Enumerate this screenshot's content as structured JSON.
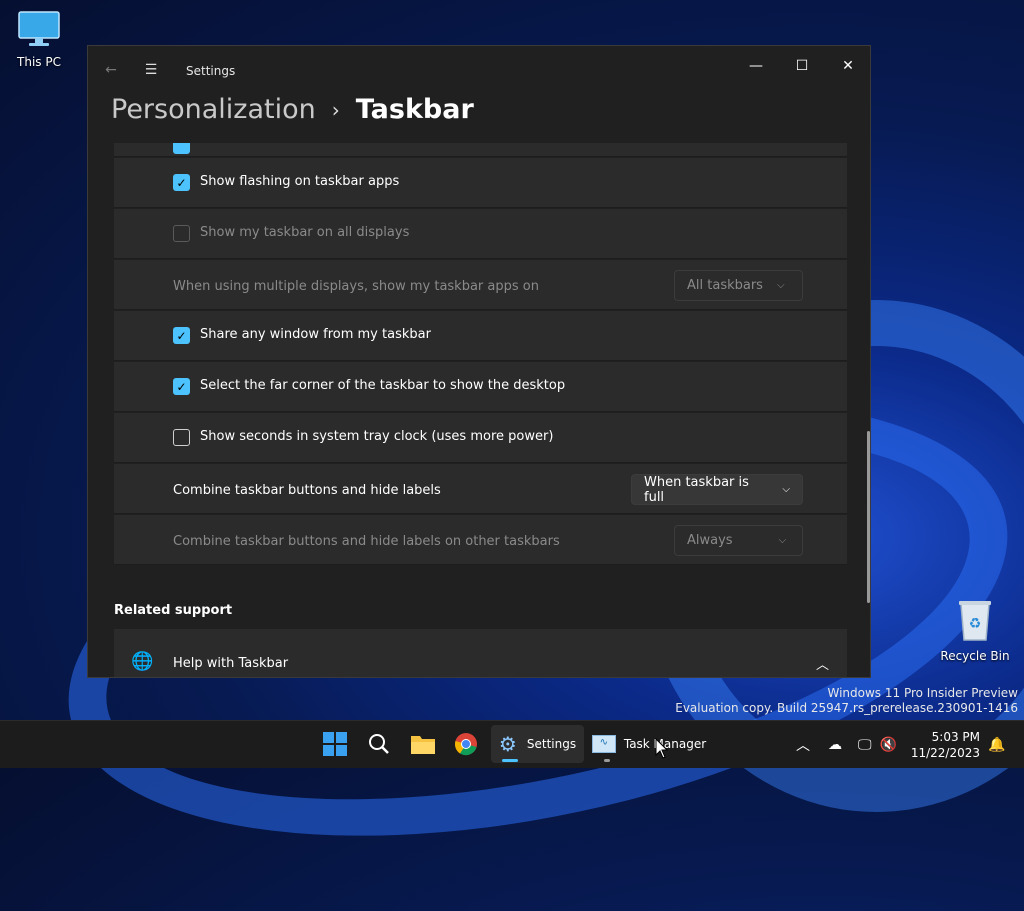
{
  "desktop": {
    "this_pc_label": "This PC",
    "recycle_bin_label": "Recycle Bin",
    "watermark_line1": "Windows 11 Pro Insider Preview",
    "watermark_line2": "Evaluation copy. Build 25947.rs_prerelease.230901-1416"
  },
  "window": {
    "app_title": "Settings",
    "breadcrumb_parent": "Personalization",
    "breadcrumb_separator": "›",
    "breadcrumb_current": "Taskbar"
  },
  "settings_rows": [
    {
      "label": "Show flashing on taskbar apps",
      "checked": true,
      "enabled": true
    },
    {
      "label": "Show my taskbar on all displays",
      "checked": false,
      "enabled": false
    },
    {
      "label": "When using multiple displays, show my taskbar apps on",
      "dropdown": "All taskbars",
      "enabled": false
    },
    {
      "label": "Share any window from my taskbar",
      "checked": true,
      "enabled": true
    },
    {
      "label": "Select the far corner of the taskbar to show the desktop",
      "checked": true,
      "enabled": true
    },
    {
      "label": "Show seconds in system tray clock (uses more power)",
      "checked": false,
      "enabled": true
    },
    {
      "label": "Combine taskbar buttons and hide labels",
      "dropdown": "When taskbar is full",
      "enabled": true
    },
    {
      "label": "Combine taskbar buttons and hide labels on other taskbars",
      "dropdown": "Always",
      "enabled": false
    }
  ],
  "related": {
    "title": "Related support",
    "help_label": "Help with Taskbar"
  },
  "taskbar": {
    "settings_label": "Settings",
    "task_manager_label": "Task Manager",
    "time": "5:03 PM",
    "date": "11/22/2023"
  },
  "colors": {
    "accent": "#4cc2ff",
    "window_bg": "#202020",
    "row_bg": "#2b2b2b"
  }
}
